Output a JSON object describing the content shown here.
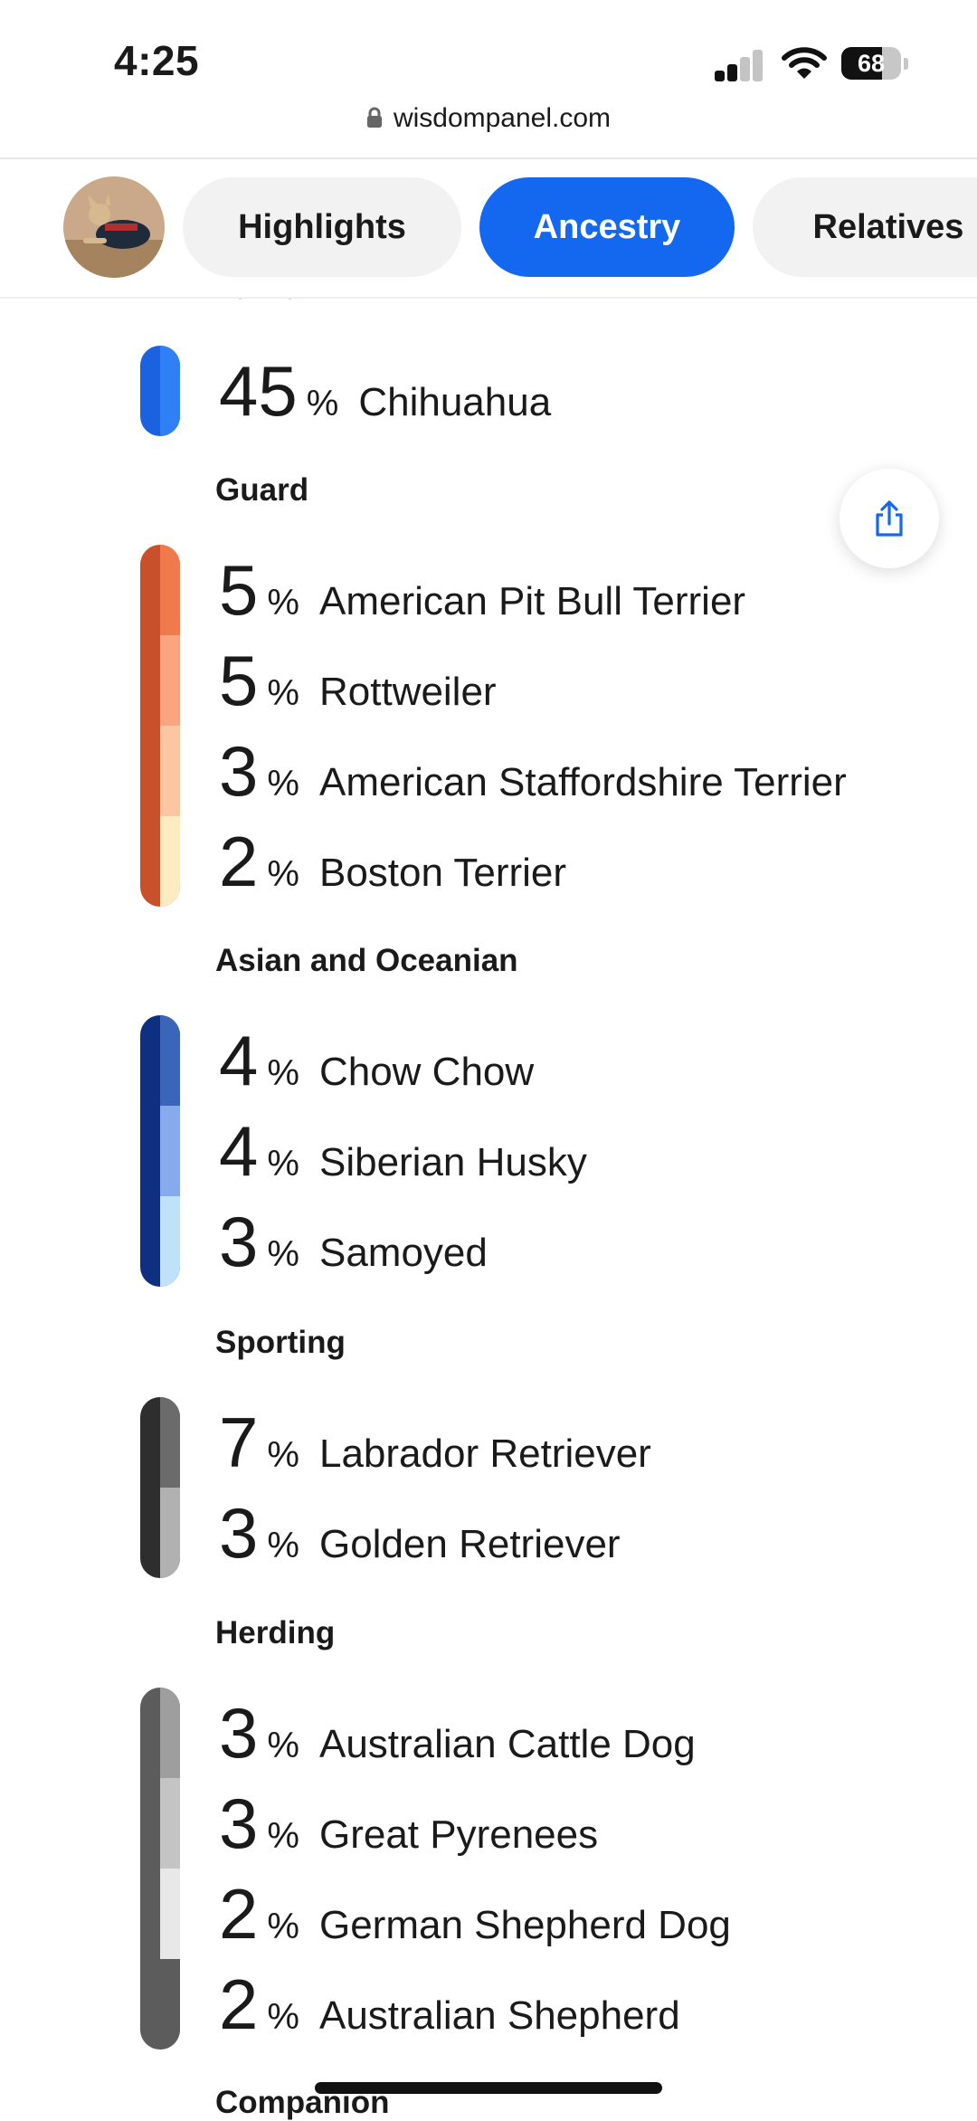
{
  "status_bar": {
    "time": "4:25",
    "battery": "68",
    "battery_level": 0.68
  },
  "browser": {
    "url": "wisdompanel.com"
  },
  "tabs": [
    {
      "label": "Highlights",
      "active": false
    },
    {
      "label": "Ancestry",
      "active": true
    },
    {
      "label": "Relatives",
      "active": false
    }
  ],
  "cut_off_top_label": "Terrier",
  "rows": {
    "r0": {
      "pct": "45",
      "unit": "%",
      "name": "Chihuahua"
    },
    "r1": {
      "pct": "5",
      "unit": "%",
      "name": "American Pit Bull Terrier"
    },
    "r2": {
      "pct": "5",
      "unit": "%",
      "name": "Rottweiler"
    },
    "r3": {
      "pct": "3",
      "unit": "%",
      "name": "American Staffordshire Terrier"
    },
    "r4": {
      "pct": "2",
      "unit": "%",
      "name": "Boston Terrier"
    },
    "r5": {
      "pct": "4",
      "unit": "%",
      "name": "Chow Chow"
    },
    "r6": {
      "pct": "4",
      "unit": "%",
      "name": "Siberian Husky"
    },
    "r7": {
      "pct": "3",
      "unit": "%",
      "name": "Samoyed"
    },
    "r8": {
      "pct": "7",
      "unit": "%",
      "name": "Labrador Retriever"
    },
    "r9": {
      "pct": "3",
      "unit": "%",
      "name": "Golden Retriever"
    },
    "r10": {
      "pct": "3",
      "unit": "%",
      "name": "Australian Cattle Dog"
    },
    "r11": {
      "pct": "3",
      "unit": "%",
      "name": "Great Pyrenees"
    },
    "r12": {
      "pct": "2",
      "unit": "%",
      "name": "German Shepherd Dog"
    },
    "r13": {
      "pct": "2",
      "unit": "%",
      "name": "Australian Shepherd"
    }
  },
  "groups": {
    "guard": "Guard",
    "asian": "Asian and Oceanian",
    "sporting": "Sporting",
    "herding": "Herding",
    "companion": "Companion"
  },
  "colors": {
    "accent": "#1468f0",
    "terrier_base": "#1a62e0",
    "terrier_seg": "#2f7ff5",
    "guard_base": "#c8502a",
    "guard_segs": [
      "#f07a4c",
      "#f9a57f",
      "#fcc6a3",
      "#fdebc2"
    ],
    "asian_base": "#0f2f80",
    "asian_segs": [
      "#3a65b8",
      "#86aaec",
      "#bfe2f8"
    ],
    "sporting_base": "#2e2e2e",
    "sporting_segs": [
      "#6b6b6b",
      "#b1b1b1"
    ],
    "herding_base": "#5c5c5c",
    "herding_segs": [
      "#9e9e9e",
      "#c4c4c4",
      "#e8e8e8",
      "#5c5c5c"
    ]
  }
}
